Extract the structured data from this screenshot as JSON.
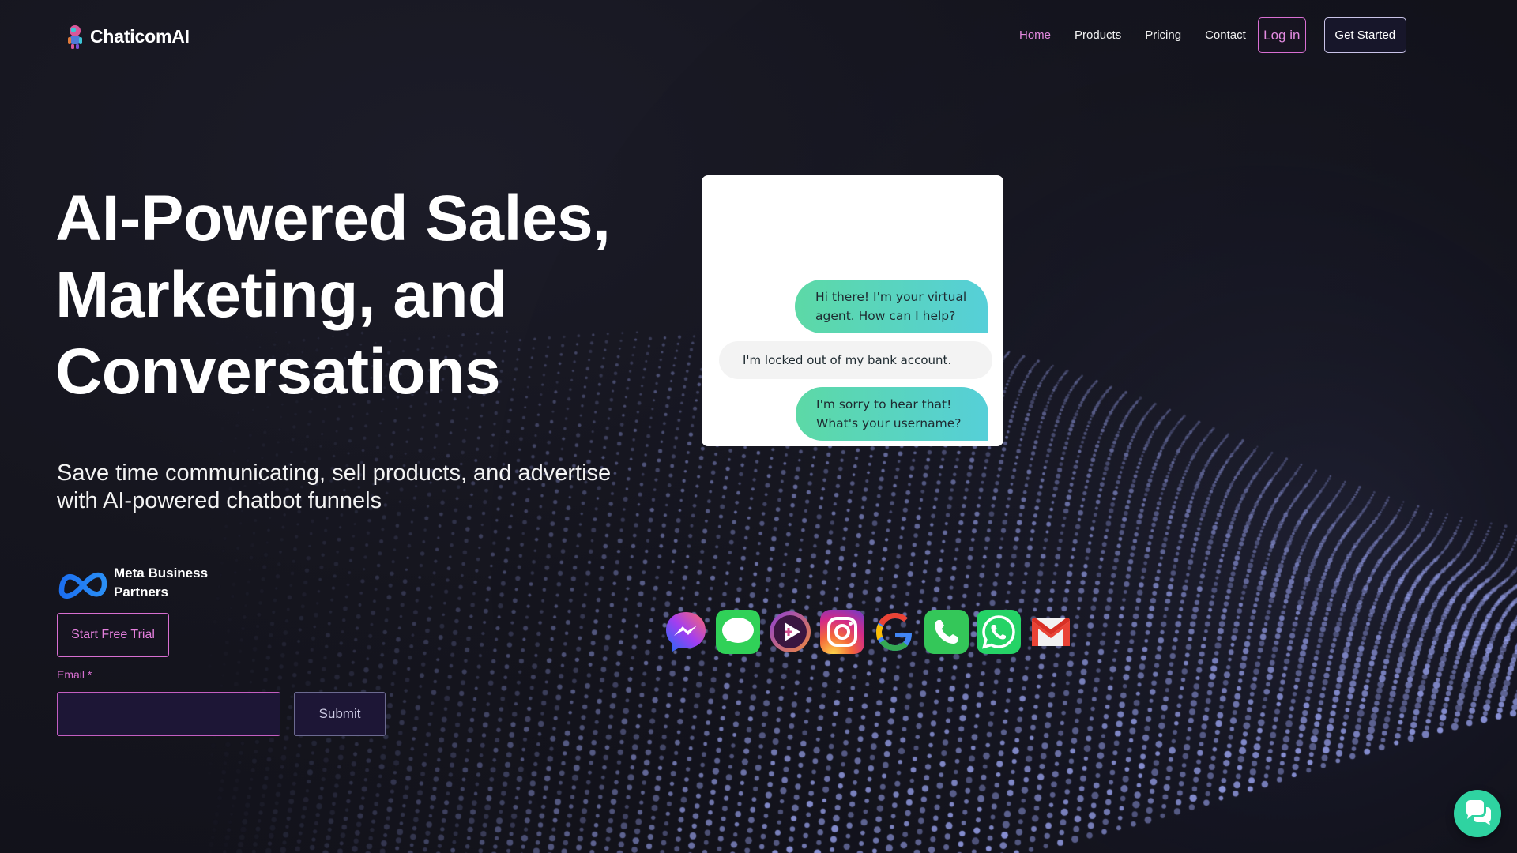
{
  "brand": {
    "name": "ChaticomAI"
  },
  "nav": {
    "items": [
      {
        "label": "Home",
        "active": true
      },
      {
        "label": "Products",
        "active": false
      },
      {
        "label": "Pricing",
        "active": false
      },
      {
        "label": "Contact",
        "active": false
      }
    ],
    "login_label": "Log in",
    "get_started_label": "Get Started"
  },
  "hero": {
    "title": "AI-Powered Sales,\nMarketing, and\nConversations",
    "subtitle": "Save time communicating, sell products, and advertise with AI-powered chatbot funnels"
  },
  "meta_badge": {
    "text": "Meta Business\nPartners"
  },
  "cta": {
    "trial_label": "Start Free Trial",
    "email_label": "Email *",
    "email_value": "",
    "submit_label": "Submit"
  },
  "chat": {
    "messages": [
      {
        "from": "bot",
        "text": "Hi there! I'm your virtual\nagent. How can I help?"
      },
      {
        "from": "user",
        "text": "I'm locked out of my bank account."
      },
      {
        "from": "bot",
        "text": "I'm sorry to hear that!\nWhat's your username?"
      }
    ]
  },
  "channels": [
    "messenger-icon",
    "imessage-icon",
    "video-icon",
    "instagram-icon",
    "google-icon",
    "phone-icon",
    "whatsapp-icon",
    "gmail-icon"
  ],
  "colors": {
    "background": "#15151e",
    "accent_pink": "#e489e0",
    "bubble_green": "#5cd9a6",
    "bubble_cyan": "#56cfd8",
    "widget": "#2fd3a1"
  }
}
